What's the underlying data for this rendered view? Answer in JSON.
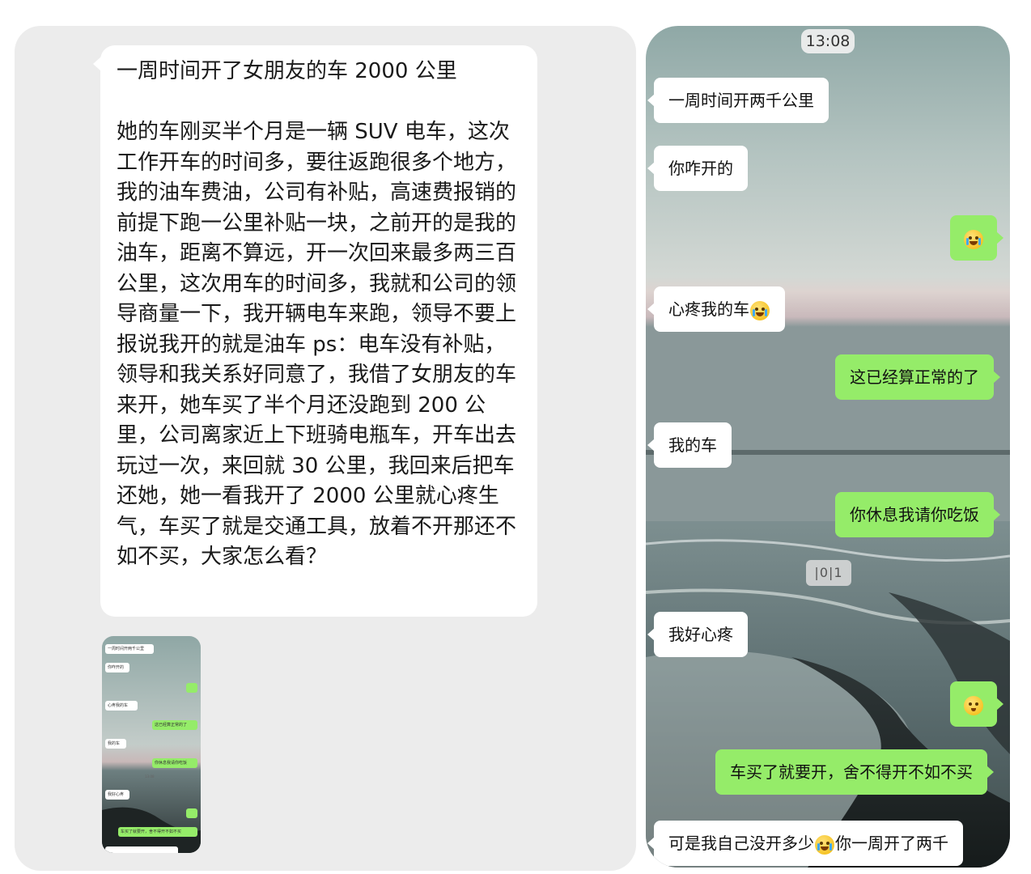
{
  "post": {
    "title": "一周时间开了女朋友的车 2000 公里",
    "body": "她的车刚买半个月是一辆 SUV 电车，这次工作开车的时间多，要往返跑很多个地方，我的油车费油，公司有补贴，高速费报销的前提下跑一公里补贴一块，之前开的是我的油车，距离不算远，开一次回来最多两三百公里，这次用车的时间多，我就和公司的领导商量一下，我开辆电车来跑，领导不要上报说我开的就是油车 ps：电车没有补贴，领导和我关系好同意了，我借了女朋友的车来开，她车买了半个月还没跑到 200 公里，公司离家近上下班骑电瓶车，开车出去玩过一次，来回就 30 公里，我回来后把车还她，她一看我开了 2000 公里就心疼生气，车买了就是交通工具，放着不开那还不如不买，大家怎么看？"
  },
  "thumbnail": {
    "messages": [
      "一周时间开两千公里",
      "你咋开的",
      "心疼我的车",
      "这已经算正常的了",
      "我的车",
      "你休息我请你吃饭",
      "13:08",
      "我好心疼",
      "车买了就要开，舍不得开不如不买"
    ]
  },
  "chat": {
    "time": "13:08",
    "video_label": "|0|1",
    "messages": [
      {
        "side": "in",
        "text": "一周时间开两千公里"
      },
      {
        "side": "in",
        "text": "你咋开的"
      },
      {
        "side": "out",
        "emoji": "laughing-tears"
      },
      {
        "side": "in",
        "text": "心疼我的车",
        "emoji": "crying"
      },
      {
        "side": "out",
        "text": "这已经算正常的了"
      },
      {
        "side": "in",
        "text": "我的车"
      },
      {
        "side": "out",
        "text": "你休息我请你吃饭"
      },
      {
        "side": "in",
        "text": "我好心疼"
      },
      {
        "side": "out",
        "emoji": "kissing"
      },
      {
        "side": "out",
        "text": "车买了就要开，舍不得开不如不买"
      },
      {
        "side": "in",
        "text_before": "可是我自己没开多少",
        "text_after": "你一周开了两千",
        "emoji": "crying"
      }
    ]
  },
  "colors": {
    "green_bubble": "#95ec69",
    "white_bubble": "#ffffff",
    "panel_bg": "#ececec"
  }
}
